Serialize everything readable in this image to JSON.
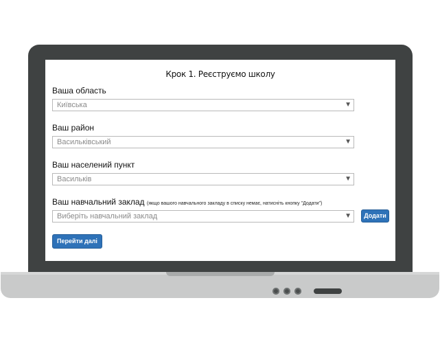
{
  "form": {
    "title": "Крок 1. Реєструємо школу",
    "region": {
      "label": "Ваша область",
      "value": "Київська"
    },
    "district": {
      "label": "Ваш район",
      "value": "Васильківський"
    },
    "settlement": {
      "label": "Ваш населений пункт",
      "value": "Васильків"
    },
    "school": {
      "label": "Ваш навчальний заклад",
      "hint": "(якщо вашого навчального закладу в списку немає, натисніть кнопку \"Додати\")",
      "placeholder": "Виберіть навчальний заклад"
    },
    "add_button": "Додати",
    "next_button": "Перейти далі"
  },
  "colors": {
    "button": "#2e72b8",
    "bezel": "#3f4242",
    "base": "#c9caca"
  },
  "icons": {
    "dropdown": "▼"
  }
}
